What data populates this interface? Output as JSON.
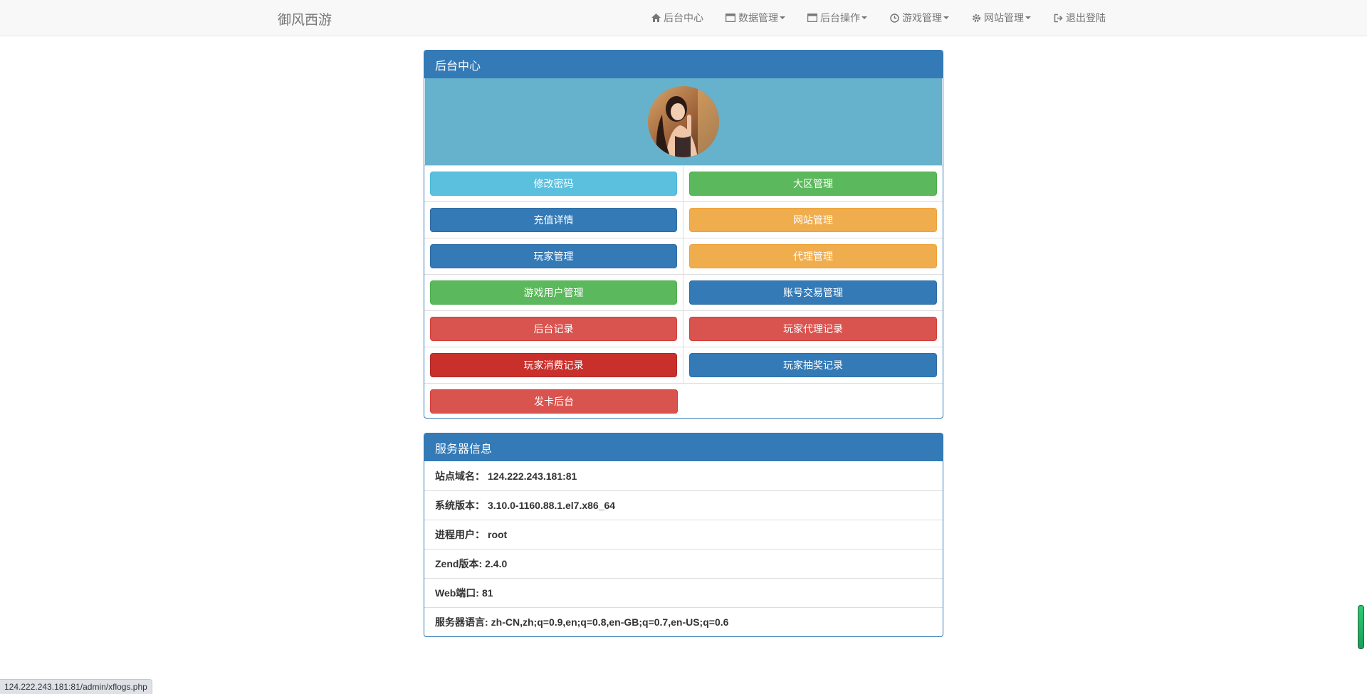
{
  "navbar": {
    "brand": "御风西游",
    "items": [
      {
        "label": "后台中心",
        "icon": "home-icon",
        "dropdown": false
      },
      {
        "label": "数据管理",
        "icon": "window-icon",
        "dropdown": true
      },
      {
        "label": "后台操作",
        "icon": "window-icon",
        "dropdown": true
      },
      {
        "label": "游戏管理",
        "icon": "clock-icon",
        "dropdown": true
      },
      {
        "label": "网站管理",
        "icon": "gear-icon",
        "dropdown": true
      },
      {
        "label": "退出登陆",
        "icon": "logout-icon",
        "dropdown": false
      }
    ]
  },
  "admin_panel": {
    "title": "后台中心",
    "buttons": [
      {
        "label": "修改密码",
        "color": "#5bc0de"
      },
      {
        "label": "大区管理",
        "color": "#5cb85c"
      },
      {
        "label": "充值详情",
        "color": "#337ab7"
      },
      {
        "label": "网站管理",
        "color": "#f0ad4e"
      },
      {
        "label": "玩家管理",
        "color": "#337ab7"
      },
      {
        "label": "代理管理",
        "color": "#f0ad4e"
      },
      {
        "label": "游戏用户管理",
        "color": "#5cb85c"
      },
      {
        "label": "账号交易管理",
        "color": "#337ab7"
      },
      {
        "label": "后台记录",
        "color": "#d9534f"
      },
      {
        "label": "玩家代理记录",
        "color": "#d9534f"
      },
      {
        "label": "玩家消费记录",
        "color": "#c9302c"
      },
      {
        "label": "玩家抽奖记录",
        "color": "#337ab7"
      },
      {
        "label": "发卡后台",
        "color": "#d9534f"
      }
    ]
  },
  "server_panel": {
    "title": "服务器信息",
    "rows": [
      {
        "label": "站点域名：",
        "value": "124.222.243.181:81"
      },
      {
        "label": "系统版本：",
        "value": "3.10.0-1160.88.1.el7.x86_64"
      },
      {
        "label": "进程用户：",
        "value": "root"
      },
      {
        "label": "Zend版本:",
        "value": "2.4.0"
      },
      {
        "label": "Web端口:",
        "value": "81"
      },
      {
        "label": "服务器语言:",
        "value": "zh-CN,zh;q=0.9,en;q=0.8,en-GB;q=0.7,en-US;q=0.6"
      }
    ]
  },
  "status_bar": {
    "url": "124.222.243.181:81/admin/xflogs.php"
  },
  "colors": {
    "primary": "#337ab7",
    "avatar_bg": "#66b1cb"
  }
}
